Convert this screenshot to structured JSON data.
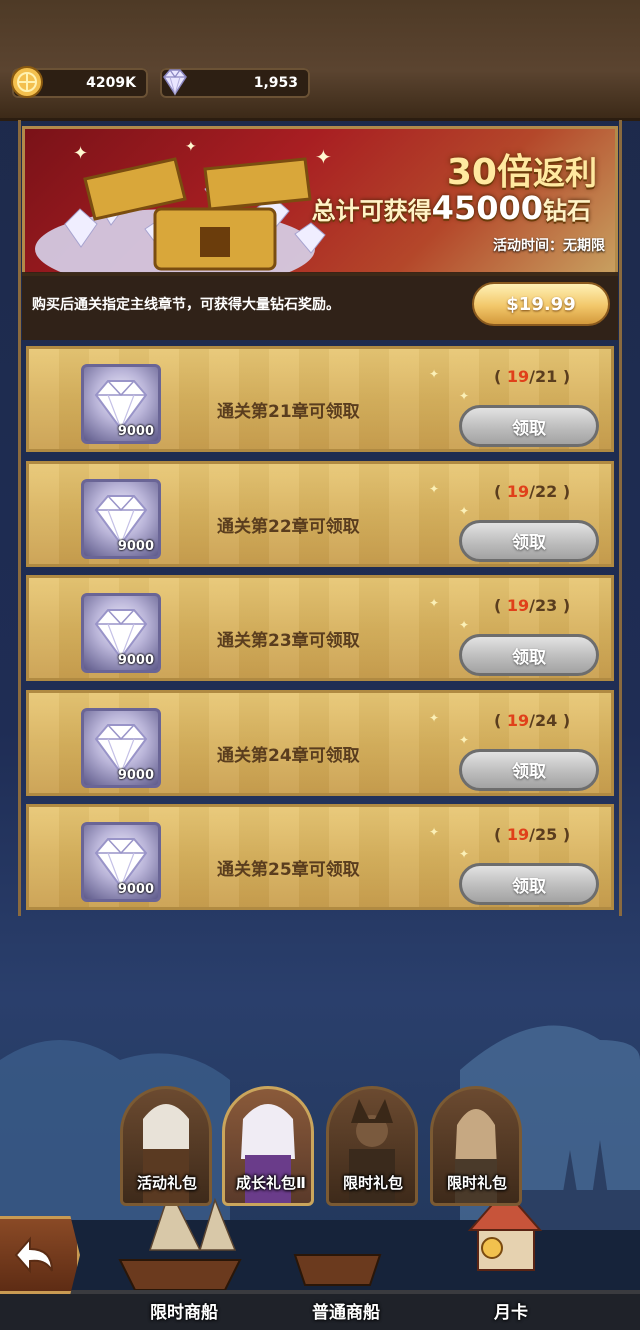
{
  "resources": {
    "gold": "4209K",
    "gems": "1,953"
  },
  "banner": {
    "multiplier": "30倍",
    "multiplier_suffix": "返利",
    "total_prefix": "总计可获得",
    "total_amount": "45000",
    "total_suffix": "钻石",
    "time_label": "活动时间：无期限",
    "description": "购买后通关指定主线章节，可获得大量钻石奖励。",
    "price": "$19.99"
  },
  "rewards": [
    {
      "label": "通关第21章可领取",
      "qty": "9000",
      "current": "19",
      "target": "/21",
      "claim": "领取"
    },
    {
      "label": "通关第22章可领取",
      "qty": "9000",
      "current": "19",
      "target": "/22",
      "claim": "领取"
    },
    {
      "label": "通关第23章可领取",
      "qty": "9000",
      "current": "19",
      "target": "/23",
      "claim": "领取"
    },
    {
      "label": "通关第24章可领取",
      "qty": "9000",
      "current": "19",
      "target": "/24",
      "claim": "领取"
    },
    {
      "label": "通关第25章可领取",
      "qty": "9000",
      "current": "19",
      "target": "/25",
      "claim": "领取"
    }
  ],
  "tabs": [
    {
      "label": "活动礼包"
    },
    {
      "label": "成长礼包Ⅱ"
    },
    {
      "label": "限时礼包"
    },
    {
      "label": "限时礼包"
    }
  ],
  "nav": [
    {
      "label": "限时商船"
    },
    {
      "label": "普通商船"
    },
    {
      "label": "月卡"
    }
  ],
  "colors": {
    "progress_current": "#e0401a",
    "row_gold": "#d8b25e",
    "claim_grey": "#bdbdbd"
  }
}
